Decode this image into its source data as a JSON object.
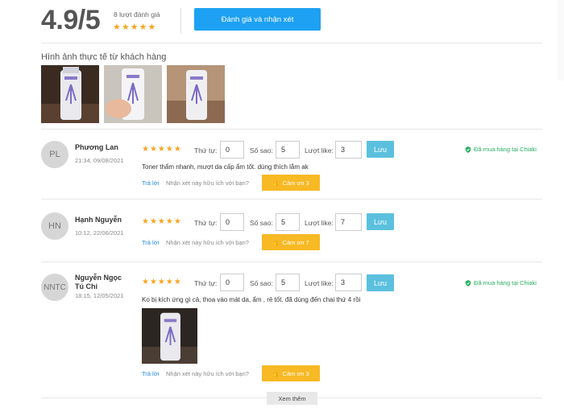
{
  "summary": {
    "score": "4.9/5",
    "count_label": "8 lượt đánh giá",
    "stars": "★★★★★",
    "rate_button": "Đánh giá và nhận xét"
  },
  "photos": {
    "title": "Hình ảnh thực tế từ khách hàng",
    "images": [
      "product-photo-bottle-dark",
      "product-photo-bottle-hand",
      "product-photo-bottle-table"
    ]
  },
  "labels": {
    "order": "Thứ tự:",
    "stars": "Số sao:",
    "likes": "Lượt like:",
    "save": "Lưu",
    "reply": "Trả lời",
    "helpful": "Nhận xét này hữu ích với bạn?",
    "bought": "Đã mua hàng tại Chiaki"
  },
  "reviews": [
    {
      "initials": "PL",
      "name": "Phương Lan",
      "date": "21:34, 09/08/2021",
      "stars": "★★★★★",
      "order": "0",
      "star_value": "5",
      "likes": "3",
      "bought": true,
      "comment": "Toner thẩm nhanh, mượt da cấp ẩm tốt. dùng thích lắm ak",
      "thanks": "Cảm ơn 3"
    },
    {
      "initials": "HN",
      "name": "Hạnh Nguyễn",
      "date": "10:12, 22/06/2021",
      "stars": "★★★★★",
      "order": "0",
      "star_value": "5",
      "likes": "7",
      "bought": false,
      "comment": "",
      "thanks": "Cảm ơn 7"
    },
    {
      "initials": "NNTC",
      "name_line1": "Nguyễn Ngọc",
      "name_line2": "Tú Chi",
      "date": "18:15, 12/05/2021",
      "stars": "★★★★★",
      "order": "0",
      "star_value": "5",
      "likes": "3",
      "bought": true,
      "comment": "Ko bị kích ứng gì cả, thoa vào mát da, ẩm , rẻ tốt. đã dùng đến chai thứ 4 rồi",
      "thanks": "Cảm ơn 3"
    }
  ],
  "more_button": "Xem thêm",
  "colors": {
    "primary": "#1ea1f2",
    "star": "#f5a623",
    "save": "#5bc0de",
    "thanks": "#f7b924",
    "bought": "#27ae60"
  }
}
